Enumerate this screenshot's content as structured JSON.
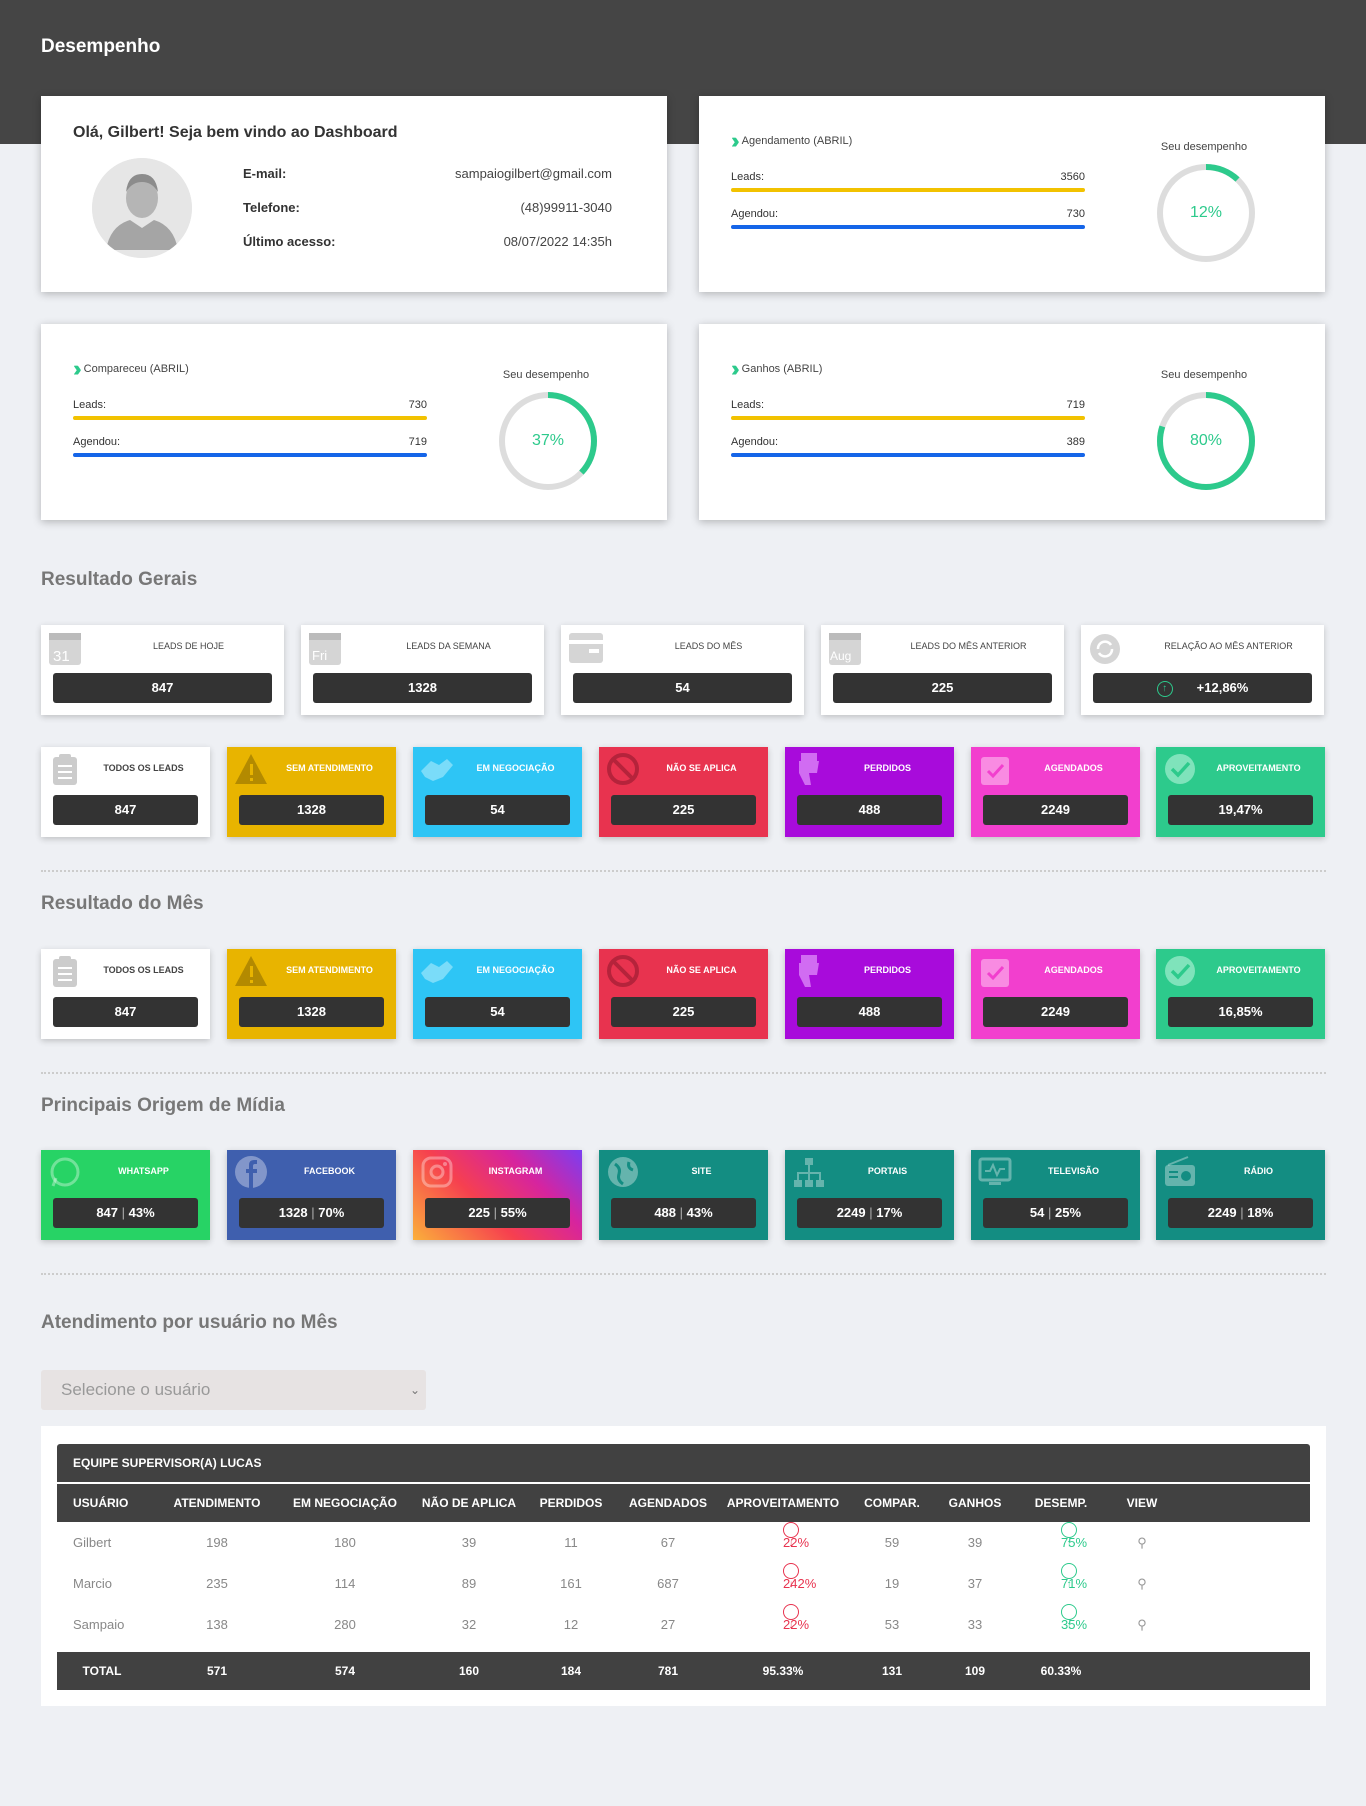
{
  "header": {
    "title": "Desempenho"
  },
  "welcome": {
    "title": "Olá, Gilbert! Seja bem vindo ao Dashboard",
    "email_label": "E-mail:",
    "email": "sampaiogilbert@gmail.com",
    "phone_label": "Telefone:",
    "phone": "(48)99911-3040",
    "last_label": "Último acesso:",
    "last": "08/07/2022 14:35h"
  },
  "stats": [
    {
      "title": "Agendamento (ABRIL)",
      "leads_label": "Leads:",
      "leads": "3560",
      "sched_label": "Agendou:",
      "sched": "730",
      "perf_label": "Seu desempenho",
      "perf": "12%",
      "perf_value": 0.12
    },
    {
      "title": "Compareceu (ABRIL)",
      "leads_label": "Leads:",
      "leads": "730",
      "sched_label": "Agendou:",
      "sched": "719",
      "perf_label": "Seu desempenho",
      "perf": "37%",
      "perf_value": 0.37
    },
    {
      "title": "Ganhos (ABRIL)",
      "leads_label": "Leads:",
      "leads": "719",
      "sched_label": "Agendou:",
      "sched": "389",
      "perf_label": "Seu desempenho",
      "perf": "80%",
      "perf_value": 0.8
    }
  ],
  "colors": {
    "accent": "#2dca8c",
    "yellow_bar": "#f2c200",
    "blue_bar": "#1565e8",
    "dark": "#414141"
  },
  "general": {
    "title": "Resultado Gerais",
    "tiles": [
      {
        "label": "LEADS DE HOJE",
        "value": "847",
        "icon": "calendar-31-icon",
        "icon_text": "31"
      },
      {
        "label": "LEADS DA SEMANA",
        "value": "1328",
        "icon": "calendar-fri-icon",
        "icon_text": "Fri"
      },
      {
        "label": "LEADS DO MÊS",
        "value": "54",
        "icon": "calendar-month-icon",
        "icon_text": ""
      },
      {
        "label": "LEADS DO MÊS ANTERIOR",
        "value": "225",
        "icon": "calendar-aug-icon",
        "icon_text": "Aug"
      },
      {
        "label": "RELAÇÃO AO MÊS ANTERIOR",
        "value": "+12,86%",
        "icon": "refresh-icon",
        "icon_text": ""
      }
    ],
    "status": [
      {
        "label": "TODOS OS LEADS",
        "value": "847"
      },
      {
        "label": "SEM ATENDIMENTO",
        "value": "1328"
      },
      {
        "label": "EM NEGOCIAÇÃO",
        "value": "54"
      },
      {
        "label": "NÃO SE APLICA",
        "value": "225"
      },
      {
        "label": "PERDIDOS",
        "value": "488"
      },
      {
        "label": "AGENDADOS",
        "value": "2249"
      },
      {
        "label": "APROVEITAMENTO",
        "value": "19,47%"
      }
    ]
  },
  "month": {
    "title": "Resultado do Mês",
    "status": [
      {
        "label": "TODOS OS LEADS",
        "value": "847"
      },
      {
        "label": "SEM ATENDIMENTO",
        "value": "1328"
      },
      {
        "label": "EM NEGOCIAÇÃO",
        "value": "54"
      },
      {
        "label": "NÃO SE APLICA",
        "value": "225"
      },
      {
        "label": "PERDIDOS",
        "value": "488"
      },
      {
        "label": "AGENDADOS",
        "value": "2249"
      },
      {
        "label": "APROVEITAMENTO",
        "value": "16,85%"
      }
    ]
  },
  "media": {
    "title": "Principais Origem de Mídia",
    "tiles": [
      {
        "label": "WHATSAPP",
        "count": "847",
        "pct": "43%"
      },
      {
        "label": "FACEBOOK",
        "count": "1328",
        "pct": "70%"
      },
      {
        "label": "INSTAGRAM",
        "count": "225",
        "pct": "55%"
      },
      {
        "label": "SITE",
        "count": "488",
        "pct": "43%"
      },
      {
        "label": "PORTAIS",
        "count": "2249",
        "pct": "17%"
      },
      {
        "label": "TELEVISÃO",
        "count": "54",
        "pct": "25%"
      },
      {
        "label": "RÁDIO",
        "count": "2249",
        "pct": "18%"
      }
    ]
  },
  "users": {
    "title": "Atendimento por usuário no Mês",
    "select_placeholder": "Selecione o usuário",
    "team": "EQUIPE SUPERVISOR(A) LUCAS",
    "columns": [
      "USUÁRIO",
      "ATENDIMENTO",
      "EM NEGOCIAÇÃO",
      "NÃO DE APLICA",
      "PERDIDOS",
      "AGENDADOS",
      "APROVEITAMENTO",
      "COMPAR.",
      "GANHOS",
      "DESEMP.",
      "VIEW"
    ],
    "rows": [
      {
        "user": "Gilbert",
        "atend": "198",
        "neg": "180",
        "nao": "39",
        "perd": "11",
        "agend": "67",
        "aprov": "22%",
        "compar": "59",
        "ganhos": "39",
        "desemp": "75%"
      },
      {
        "user": "Marcio",
        "atend": "235",
        "neg": "114",
        "nao": "89",
        "perd": "161",
        "agend": "687",
        "aprov": "242%",
        "compar": "19",
        "ganhos": "37",
        "desemp": "71%"
      },
      {
        "user": "Sampaio",
        "atend": "138",
        "neg": "280",
        "nao": "32",
        "perd": "12",
        "agend": "27",
        "aprov": "22%",
        "compar": "53",
        "ganhos": "33",
        "desemp": "35%"
      }
    ],
    "total": {
      "label": "TOTAL",
      "atend": "571",
      "neg": "574",
      "nao": "160",
      "perd": "184",
      "agend": "781",
      "aprov": "95.33%",
      "compar": "131",
      "ganhos": "109",
      "desemp": "60.33%"
    }
  }
}
